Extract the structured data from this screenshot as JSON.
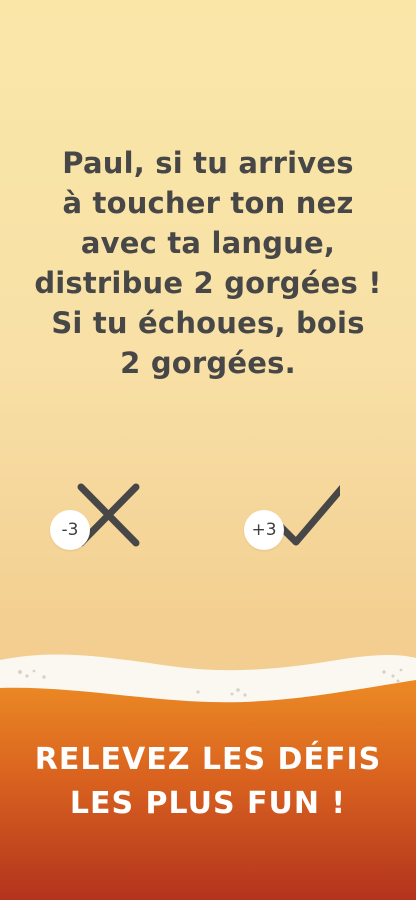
{
  "challenge": {
    "lines": [
      "Paul, si tu arrives",
      "à toucher ton nez",
      "avec ta langue,",
      "distribue 2 gorgées !",
      "Si tu échoues, bois",
      "2 gorgées."
    ]
  },
  "actions": {
    "fail": {
      "score": "-3",
      "icon": "close-icon"
    },
    "success": {
      "score": "+3",
      "icon": "checkmark-icon"
    }
  },
  "tagline": {
    "lines": [
      "Relevez les défis",
      "les plus fun !"
    ]
  },
  "colors": {
    "background_top": "#fae7a8",
    "background_bottom": "#f0c687",
    "text": "#474747",
    "foam": "#fbf8f2",
    "beer_top": "#ec8a24",
    "beer_bottom": "#b3331e"
  }
}
